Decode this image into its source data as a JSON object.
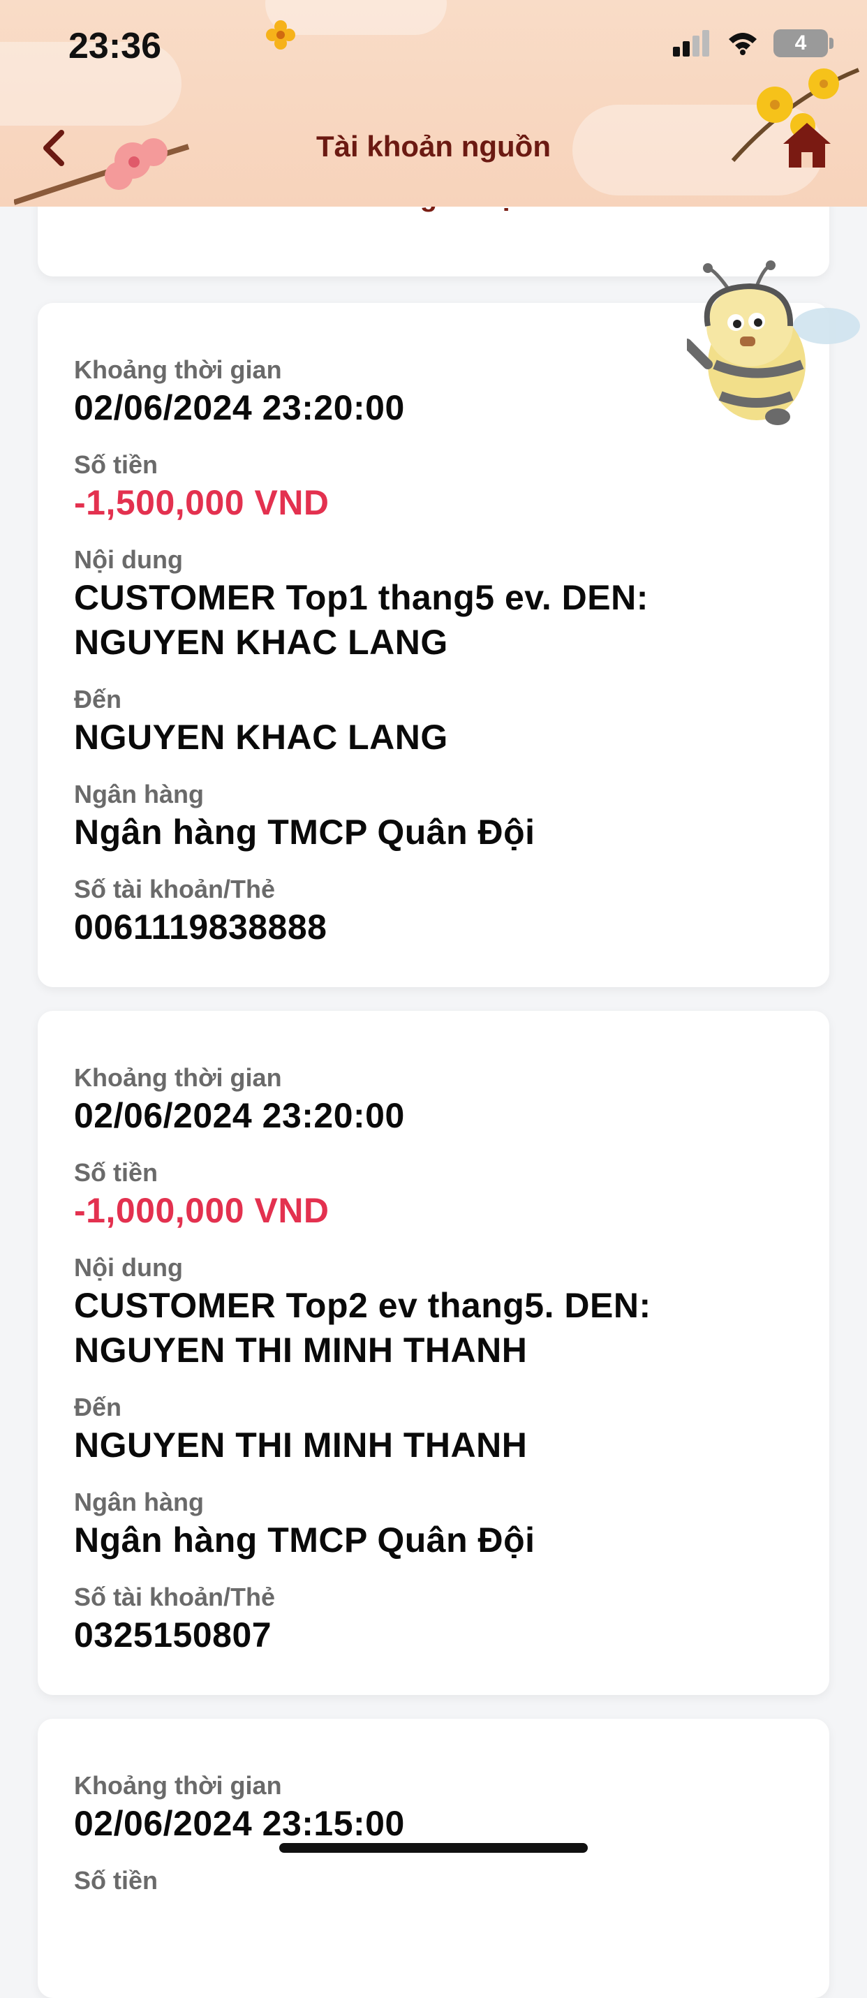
{
  "status_bar": {
    "time": "23:36",
    "battery": "4"
  },
  "header": {
    "title": "Tài khoản nguồn"
  },
  "top_link": {
    "label": "Tra soát giao dịch"
  },
  "transactions": [
    {
      "time_label": "Khoảng thời gian",
      "time": "02/06/2024 23:20:00",
      "amount_label": "Số tiền",
      "amount": "-1,500,000 VND",
      "content_label": "Nội dung",
      "content_line1": "CUSTOMER Top1 thang5 ev. DEN:",
      "content_line2": "NGUYEN KHAC LANG",
      "to_label": "Đến",
      "to": "NGUYEN KHAC LANG",
      "bank_label": "Ngân hàng",
      "bank": "Ngân hàng TMCP Quân Đội",
      "account_label": "Số tài khoản/Thẻ",
      "account": "0061119838888"
    },
    {
      "time_label": "Khoảng thời gian",
      "time": "02/06/2024 23:20:00",
      "amount_label": "Số tiền",
      "amount": "-1,000,000 VND",
      "content_label": "Nội dung",
      "content_line1": "CUSTOMER Top2 ev thang5. DEN:",
      "content_line2": "NGUYEN THI MINH THANH",
      "to_label": "Đến",
      "to": "NGUYEN THI MINH THANH",
      "bank_label": "Ngân hàng",
      "bank": "Ngân hàng TMCP Quân Đội",
      "account_label": "Số tài khoản/Thẻ",
      "account": "0325150807"
    },
    {
      "time_label": "Khoảng thời gian",
      "time": "02/06/2024 23:15:00",
      "amount_label": "Số tiền"
    }
  ]
}
